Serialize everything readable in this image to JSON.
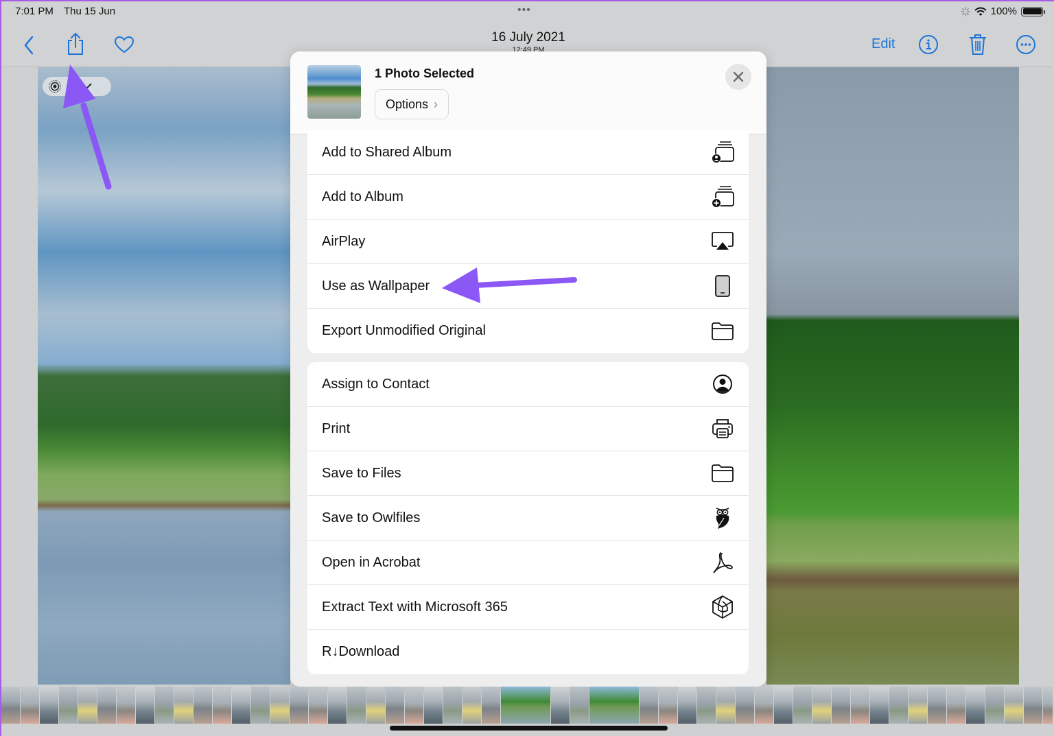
{
  "status_bar": {
    "time": "7:01 PM",
    "date": "Thu 15 Jun",
    "multitask_dots": "•••",
    "battery_percent": "100%",
    "icons": [
      "activity-spinner-icon",
      "wifi-icon",
      "battery-icon"
    ]
  },
  "nav_bar": {
    "title": "16 July 2021",
    "subtitle": "12:49 PM",
    "edit_label": "Edit",
    "left_icons": [
      "back-chevron-icon",
      "share-icon",
      "heart-icon"
    ],
    "right_icons": [
      "info-icon",
      "trash-icon",
      "more-icon"
    ]
  },
  "live_photo": {
    "icon": "live-photo-icon",
    "dropdown_icon": "chevron-down-icon"
  },
  "share_sheet": {
    "title": "1 Photo Selected",
    "options_label": "Options",
    "options_chevron": "›",
    "close_icon": "close-icon",
    "group_1": [
      {
        "label": "Add to Shared Album",
        "icon": "shared-album-icon"
      },
      {
        "label": "Add to Album",
        "icon": "add-album-icon"
      },
      {
        "label": "AirPlay",
        "icon": "airplay-icon"
      },
      {
        "label": "Use as Wallpaper",
        "icon": "wallpaper-device-icon"
      },
      {
        "label": "Export Unmodified Original",
        "icon": "folder-icon"
      }
    ],
    "group_2": [
      {
        "label": "Assign to Contact",
        "icon": "contact-icon"
      },
      {
        "label": "Print",
        "icon": "printer-icon"
      },
      {
        "label": "Save to Files",
        "icon": "folder-icon"
      },
      {
        "label": "Save to Owlfiles",
        "icon": "owl-icon"
      },
      {
        "label": "Open in Acrobat",
        "icon": "acrobat-icon"
      },
      {
        "label": "Extract Text with Microsoft 365",
        "icon": "microsoft-365-icon"
      },
      {
        "label": "R↓Download",
        "icon": ""
      }
    ]
  },
  "colors": {
    "accent": "#1a73d9",
    "annotation_arrow": "#8b57f5",
    "sheet_bg": "#edeeed"
  }
}
